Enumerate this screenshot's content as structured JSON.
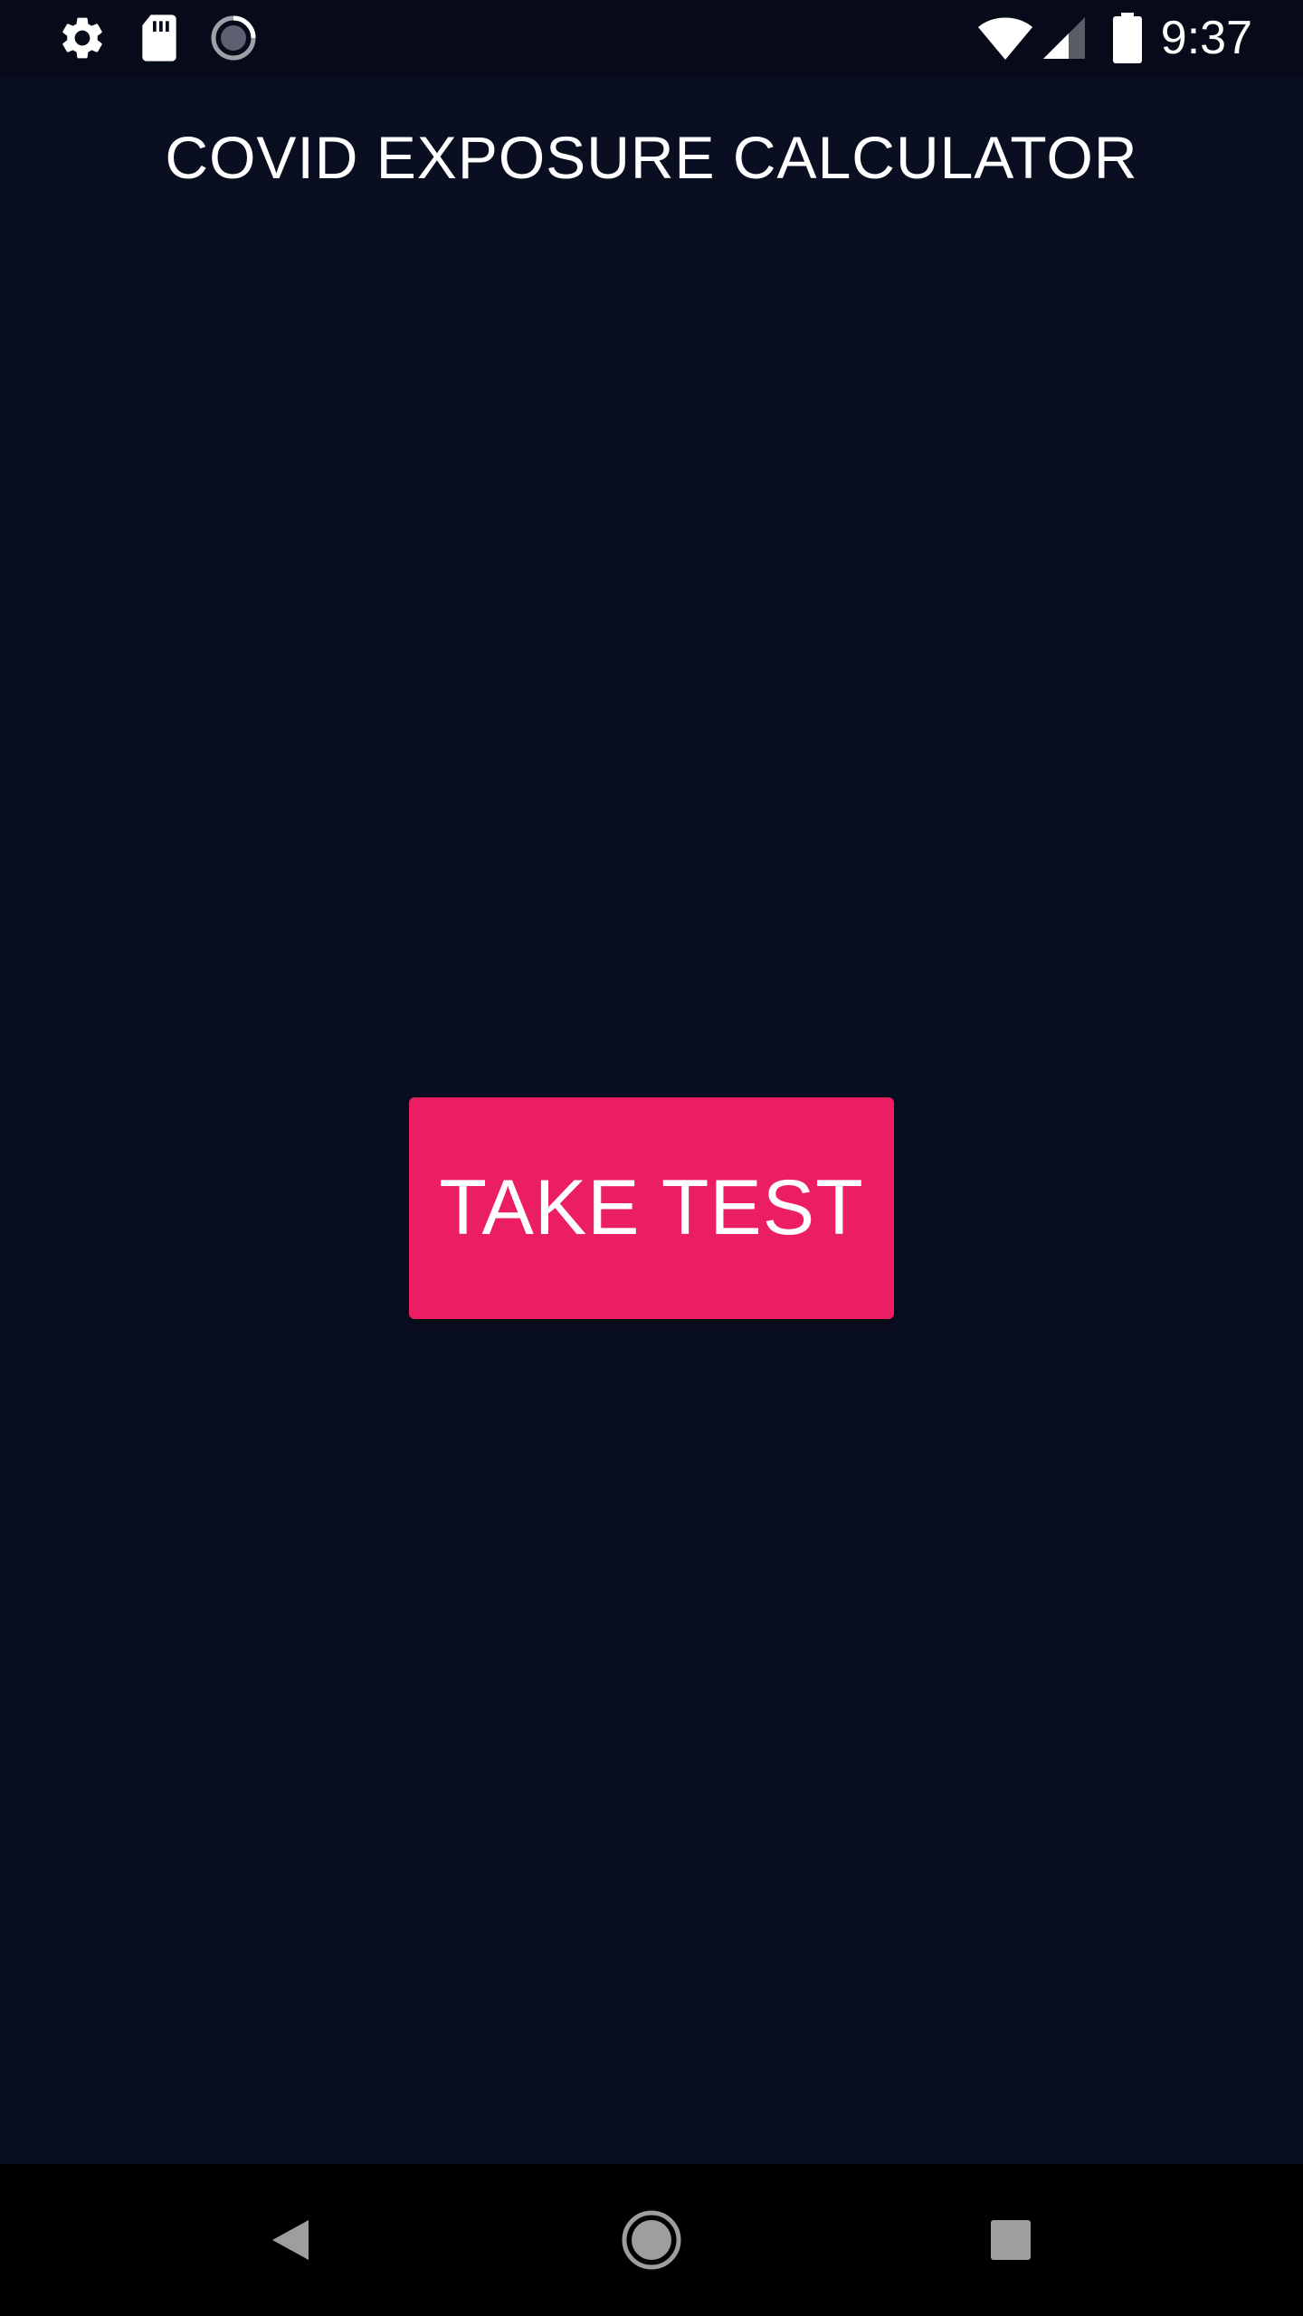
{
  "status_bar": {
    "time": "9:37",
    "left_icons": [
      "gear-icon",
      "sd-card-icon",
      "loading-icon"
    ],
    "right_icons": [
      "wifi-icon",
      "cell-signal-icon",
      "battery-icon"
    ]
  },
  "app_bar": {
    "title": "COVID EXPOSURE CALCULATOR"
  },
  "main": {
    "take_test_label": "TAKE TEST"
  },
  "nav_bar": {
    "buttons": [
      "back-icon",
      "home-icon",
      "recents-icon"
    ]
  },
  "colors": {
    "background": "#0a0e21",
    "status_bar": "#070a18",
    "accent": "#eb1e63",
    "nav_bar": "#000000"
  }
}
